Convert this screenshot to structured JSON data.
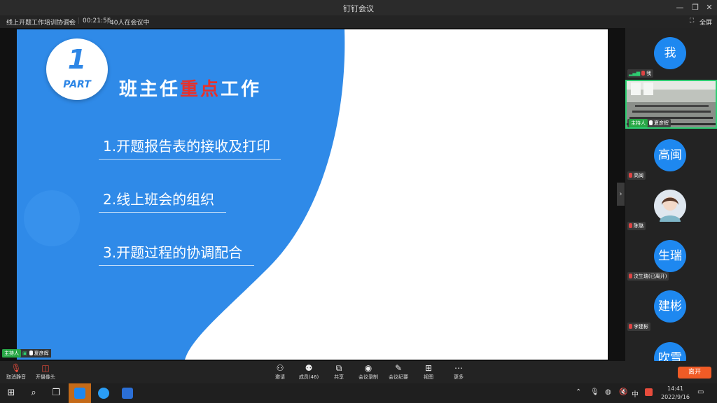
{
  "window": {
    "title": "钉钉会议",
    "minimize": "—",
    "restore": "❐",
    "close": "✕"
  },
  "meeting": {
    "name": "线上开题工作培训协调会",
    "duration": "00:21:56",
    "attendees": "40人在会议中",
    "fullscreen": "全屏"
  },
  "slide": {
    "badge_number": "1",
    "badge_part": "PART",
    "heading_prefix": "班主任",
    "heading_highlight": "重点",
    "heading_suffix": "工作",
    "items": [
      "1.开题报告表的接收及打印",
      "2.线上班会的组织",
      "3.开题过程的协调配合"
    ]
  },
  "presenter_tag": {
    "role": "主持人",
    "name": "夏彦辉"
  },
  "participants": [
    {
      "avatar_text": "我",
      "name": "我"
    },
    {
      "host": "主持人",
      "name": "夏彦辉"
    },
    {
      "avatar_text": "高闽",
      "name": "高闽"
    },
    {
      "name": "陈璐"
    },
    {
      "avatar_text": "生瑞",
      "name": "汶生瑞(已离开)"
    },
    {
      "avatar_text": "建彬",
      "name": "李建彬"
    },
    {
      "avatar_text": "吹雪"
    }
  ],
  "toolbar": {
    "mute": "取消静音",
    "camera": "开摄像头",
    "invite": "邀请",
    "members": "成员(46)",
    "share": "共享",
    "record": "会议录制",
    "minutes": "会议纪要",
    "view": "视图",
    "more": "更多",
    "leave": "离开"
  },
  "taskbar": {
    "time": "14:41",
    "date": "2022/9/16",
    "ime": "中"
  },
  "colors": {
    "accent_blue": "#1e88f0",
    "leave_orange": "#f05b26",
    "host_green": "#27a745",
    "highlight_red": "#e8302a"
  }
}
